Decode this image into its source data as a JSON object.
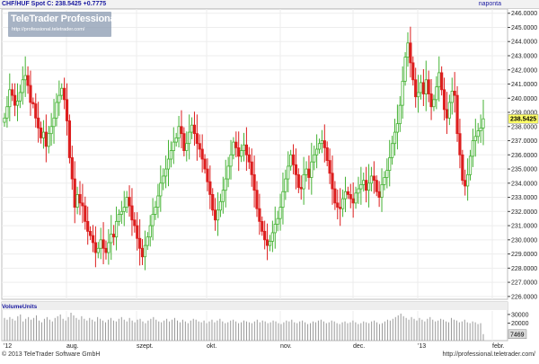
{
  "header": {
    "title": "CHF/HUF Spot C: 238.5425 +0.7775",
    "right_label": "naponta"
  },
  "watermark": {
    "title": "TeleTrader Professional",
    "url": "http://professional.teletrader.com/"
  },
  "volume_panel": {
    "label": "VolumeUnits"
  },
  "footer": {
    "copyright": "© 2013 TeleTrader Software GmbH",
    "url": "http://professional.teletrader.com/"
  },
  "colors": {
    "up": "#44b233",
    "down": "#dd1e1e",
    "grid": "#ededed",
    "axis_text": "#222222",
    "volume": "#9a9a9a",
    "last_price_box": "#ffff66"
  },
  "chart_data": [
    {
      "type": "candlestick",
      "title": "CHF/HUF Spot",
      "last_price": "238.5425",
      "ylim": [
        225.8,
        246.3
      ],
      "yticks": [
        "246.0000",
        "245.0000",
        "244.0000",
        "243.0000",
        "242.0000",
        "241.0000",
        "240.0000",
        "239.0000",
        "238.0000",
        "237.0000",
        "236.0000",
        "235.0000",
        "234.0000",
        "233.0000",
        "232.0000",
        "231.0000",
        "230.0000",
        "229.0000",
        "228.0000",
        "227.0000",
        "226.0000"
      ],
      "xticks": [
        "'12",
        "aug.",
        "szept.",
        "okt.",
        "nov.",
        "dec.",
        "'13",
        "febr."
      ],
      "grid": true,
      "period": "naponta",
      "closes": [
        238.6,
        239.4,
        240.6,
        240.2,
        239.5,
        239.8,
        240.4,
        241.3,
        241.6,
        240.9,
        239.7,
        239.6,
        238.6,
        237.9,
        237.2,
        237.6,
        236.6,
        237.5,
        238.0,
        238.6,
        239.7,
        240.2,
        240.7,
        239.9,
        238.4,
        235.8,
        234.3,
        232.3,
        233.2,
        232.6,
        232.4,
        231.3,
        230.6,
        230.3,
        229.8,
        229.1,
        229.4,
        230.0,
        229.4,
        229.1,
        229.8,
        230.4,
        230.2,
        231.3,
        231.8,
        232.0,
        232.3,
        233.0,
        232.4,
        231.4,
        231.0,
        230.1,
        229.4,
        228.8,
        229.6,
        230.2,
        231.0,
        231.8,
        232.3,
        233.1,
        234.0,
        234.5,
        235.0,
        235.7,
        236.3,
        236.9,
        237.2,
        238.0,
        237.5,
        236.3,
        236.8,
        237.6,
        238.1,
        237.5,
        236.8,
        236.4,
        235.7,
        235.0,
        234.1,
        233.2,
        232.1,
        231.4,
        232.1,
        232.7,
        233.5,
        234.3,
        235.2,
        236.0,
        236.9,
        236.5,
        235.9,
        236.3,
        236.7,
        236.0,
        235.5,
        234.6,
        233.5,
        232.2,
        231.3,
        230.6,
        230.0,
        229.6,
        229.9,
        230.5,
        231.1,
        231.5,
        232.3,
        233.4,
        234.3,
        235.2,
        236.0,
        235.3,
        234.6,
        233.7,
        233.6,
        234.6,
        235.0,
        234.4,
        235.5,
        236.0,
        236.4,
        236.8,
        237.0,
        236.5,
        235.6,
        234.7,
        233.6,
        232.6,
        232.3,
        232.2,
        232.9,
        233.4,
        233.2,
        232.9,
        232.6,
        233.3,
        233.6,
        233.9,
        234.2,
        233.5,
        234.0,
        234.5,
        234.2,
        233.4,
        233.0,
        233.9,
        234.4,
        234.9,
        235.8,
        236.8,
        237.6,
        238.2,
        239.5,
        241.2,
        242.9,
        243.9,
        242.5,
        241.3,
        240.1,
        240.4,
        241.1,
        240.3,
        241.3,
        240.3,
        239.4,
        239.9,
        240.8,
        241.8,
        240.6,
        239.2,
        238.6,
        239.7,
        240.5,
        240.2,
        237.5,
        236.0,
        234.2,
        233.8,
        234.6,
        235.9,
        237.0,
        237.3,
        237.7,
        237.9,
        238.5425
      ]
    },
    {
      "type": "bar",
      "title": "VolumeUnits",
      "yticks": [
        "30000",
        "20000",
        "7469"
      ],
      "last_value": 7469,
      "ylim": [
        0,
        34000
      ],
      "values": [
        26000,
        24000,
        27000,
        25000,
        23000,
        28000,
        30000,
        22000,
        25000,
        27000,
        24000,
        26000,
        29000,
        23000,
        21000,
        25000,
        27000,
        24000,
        22000,
        26000,
        28000,
        30000,
        25000,
        23000,
        27000,
        32000,
        29000,
        26000,
        24000,
        28000,
        25000,
        23000,
        26000,
        24000,
        22000,
        27000,
        25000,
        23000,
        21000,
        24000,
        26000,
        23000,
        22000,
        25000,
        27000,
        24000,
        22000,
        26000,
        23000,
        21000,
        24000,
        25000,
        22000,
        20000,
        23000,
        25000,
        27000,
        24000,
        22000,
        21000,
        23000,
        25000,
        22000,
        24000,
        26000,
        23000,
        21000,
        24000,
        22000,
        20000,
        23000,
        25000,
        24000,
        22000,
        21000,
        23000,
        20000,
        22000,
        24000,
        21000,
        23000,
        25000,
        22000,
        20000,
        21000,
        23000,
        24000,
        22000,
        20000,
        21000,
        23000,
        22000,
        21000,
        20000,
        22000,
        24000,
        21000,
        23000,
        22000,
        20000,
        21000,
        23000,
        22000,
        20000,
        19000,
        21000,
        23000,
        22000,
        24000,
        21000,
        20000,
        22000,
        23000,
        21000,
        19000,
        20000,
        22000,
        21000,
        23000,
        24000,
        22000,
        20000,
        21000,
        23000,
        22000,
        20000,
        19000,
        21000,
        22000,
        20000,
        21000,
        23000,
        21000,
        19000,
        20000,
        22000,
        21000,
        20000,
        22000,
        23000,
        21000,
        19000,
        20000,
        22000,
        24000,
        23000,
        25000,
        27000,
        29000,
        31000,
        28000,
        26000,
        24000,
        27000,
        25000,
        23000,
        26000,
        24000,
        22000,
        25000,
        27000,
        24000,
        22000,
        23000,
        25000,
        24000,
        22000,
        21000,
        26000,
        24000,
        23000,
        21000,
        22000,
        24000,
        21000,
        20000,
        22000,
        21000,
        19000,
        20000,
        7469
      ]
    }
  ]
}
